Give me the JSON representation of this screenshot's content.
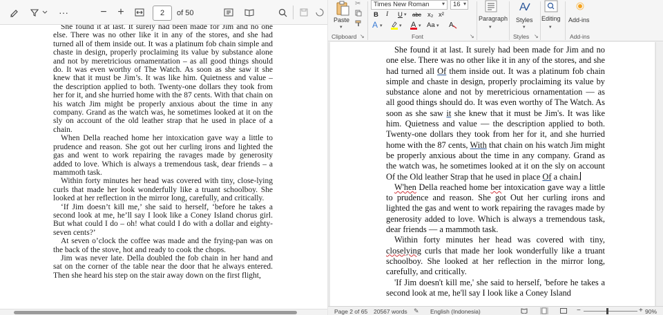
{
  "pdf": {
    "toolbar": {
      "page_value": "2",
      "page_total": "of 50"
    },
    "paragraphs": [
      "She found it at last. It surely had been made for Jim and no one else. There was no other like it in any of the stores, and she had turned all of them inside out. It was a platinum fob chain simple and chaste in design, properly proclaiming its value by substance alone and not by meretricious ornamentation – as all good things should do. It was even worthy of The Watch. As soon as she saw it she knew that it must be Jim’s. It was like him. Quietness and value – the description applied to both. Twenty-one dollars they took from her for it, and she hurried home with the 87 cents. With that chain on his watch Jim might be properly anxious about the time in any company. Grand as the watch was, he sometimes looked at it on the sly on account of the old leather strap that he used in place of a chain.",
      "When Della reached home her intoxication gave way a little to prudence and reason. She got out her curling irons and lighted the gas and went to work repairing the ravages made by generosity added to love. Which is always a tremendous task, dear friends – a mammoth task.",
      "Within forty minutes her head was covered with tiny, close-lying curls that made her look wonderfully like a truant schoolboy. She looked at her reflection in the mirror long, carefully, and critically.",
      "‘If Jim doesn’t kill me,’ she said to herself, ‘before he takes a second look at me, he’ll say I look like a Coney Island chorus girl. But what could I do – oh! what could I do with a dollar and eighty-seven cents?’",
      "At seven o’clock the coffee was made and the frying-pan was on the back of the stove, hot and ready to cook the chops.",
      "Jim was never late. Della doubled the fob chain in her hand and sat on the corner of the table near the door that he always entered. Then she heard his step on the stair away down on the first flight,"
    ]
  },
  "word": {
    "ribbon": {
      "font_name": "Times New Roman",
      "font_size": "16",
      "paste_label": "Paste",
      "clipboard_label": "Clipboard",
      "font_label": "Font",
      "paragraph_label": "Paragraph",
      "styles_label": "Styles",
      "styles_group_label": "Styles",
      "editing_label": "Editing",
      "addins_label": "Add-ins",
      "addins_group_label": "Add-ins",
      "bold": "B",
      "italic": "I",
      "underline": "U",
      "strike": "abc",
      "subscript": "x₂",
      "superscript": "x²",
      "change_case": "Aa"
    },
    "doc": {
      "p1_a": "She found it at last. It surely had been made for Jim and no one else. There was no other like it in any of the stores, and she had turned all ",
      "p1_of": "Of",
      "p1_b": " them inside out. It was a platinum fob chain simple and chaste in design, properly proclaiming its value by substance alone and not by meretricious ornamentation — as all good things should do. It was even worthy of The Watch. As soon as she saw ",
      "p1_it": "it",
      "p1_c": " she knew that it must be Jim's. It was like him. Quietness and value — the description applied to both. Twenty-one dollars they took from her for it, and she hurried home with the 87 cents, ",
      "p1_with": "With",
      "p1_d": " that chain on his watch Jim might be properly anxious about the time in any company. Grand as the watch was, he sometimes looked at it on the sly on account Of the Old leather Strap that he used in place ",
      "p1_of2": "Of",
      "p1_e": " a chain.",
      "p2_when": "W'hen",
      "p2_a": " Della reached home ",
      "p2_ber": "ber",
      "p2_b": " intoxication gave way a little to prudence and reason. She got Out her curling irons and lighted the gas and went to work repairing the ravages made by generosity added to love. Which is always a tremendous task, dear friends — a mammoth task.",
      "p3_a": "Within forty minutes her head was covered with tiny, ",
      "p3_closelyng": "closelying",
      "p3_b": " curls that made her look wonderfully like a truant schoolboy. She looked at her reflection in the mirror long, carefully, and critically.",
      "p4": "'If Jim doesn't kill me,' she said to herself, 'before he takes a second look at me, he'll say I look like a Coney Island"
    },
    "status": {
      "page": "Page 2 of 65",
      "words": "20567 words",
      "language": "English (Indonesia)",
      "zoom": "90%"
    }
  }
}
